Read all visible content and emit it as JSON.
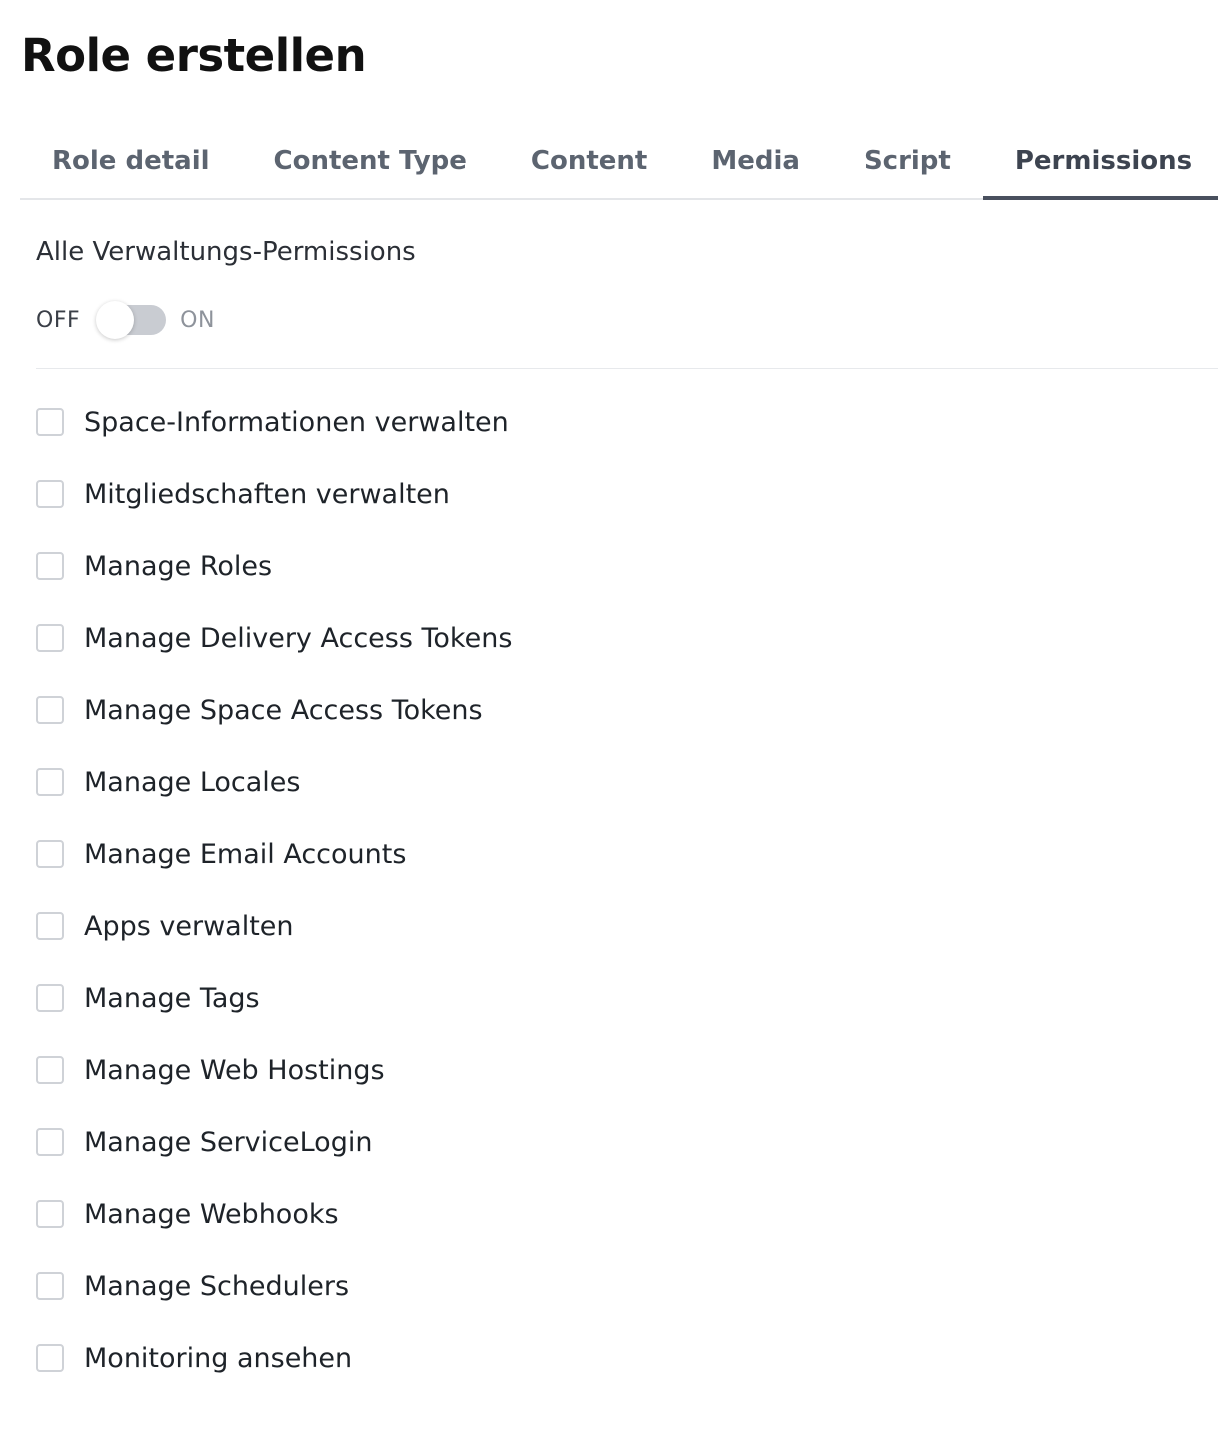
{
  "page": {
    "title": "Role erstellen"
  },
  "tabs": [
    {
      "label": "Role detail",
      "active": false
    },
    {
      "label": "Content Type",
      "active": false
    },
    {
      "label": "Content",
      "active": false
    },
    {
      "label": "Media",
      "active": false
    },
    {
      "label": "Script",
      "active": false
    },
    {
      "label": "Permissions",
      "active": true
    }
  ],
  "all_permissions": {
    "label": "Alle Verwaltungs-Permissions",
    "toggle": {
      "off_label": "OFF",
      "on_label": "ON",
      "state": "off"
    }
  },
  "permissions": [
    {
      "label": "Space-Informationen verwalten",
      "checked": false
    },
    {
      "label": "Mitgliedschaften verwalten",
      "checked": false
    },
    {
      "label": "Manage Roles",
      "checked": false
    },
    {
      "label": "Manage Delivery Access Tokens",
      "checked": false
    },
    {
      "label": "Manage Space Access Tokens",
      "checked": false
    },
    {
      "label": "Manage Locales",
      "checked": false
    },
    {
      "label": "Manage Email Accounts",
      "checked": false
    },
    {
      "label": "Apps verwalten",
      "checked": false
    },
    {
      "label": "Manage Tags",
      "checked": false
    },
    {
      "label": "Manage Web Hostings",
      "checked": false
    },
    {
      "label": "Manage ServiceLogin",
      "checked": false
    },
    {
      "label": "Manage Webhooks",
      "checked": false
    },
    {
      "label": "Manage Schedulers",
      "checked": false
    },
    {
      "label": "Monitoring ansehen",
      "checked": false
    }
  ],
  "colors": {
    "active_tab_underline": "#49505e",
    "switch_track": "#c9ccd2",
    "checkbox_border": "#cfd2d7"
  }
}
